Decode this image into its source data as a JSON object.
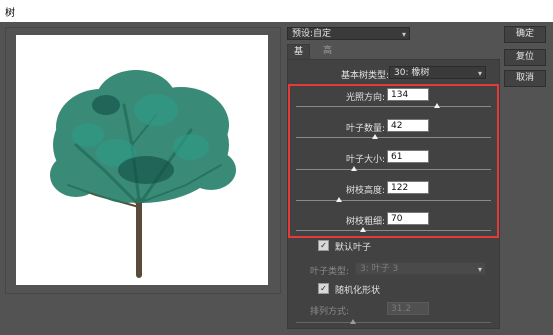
{
  "window": {
    "title": "树"
  },
  "preset": {
    "label": "预设:",
    "value": "自定"
  },
  "tabs": [
    {
      "label": "基本"
    },
    {
      "label": "高级"
    }
  ],
  "tree_type": {
    "label": "基本树类型:",
    "value": "30: 橡树"
  },
  "params": [
    {
      "label": "光照方向:",
      "value": "134"
    },
    {
      "label": "叶子数量:",
      "value": "42"
    },
    {
      "label": "叶子大小:",
      "value": "61"
    },
    {
      "label": "树枝高度:",
      "value": "122"
    },
    {
      "label": "树枝粗细:",
      "value": "70"
    }
  ],
  "default_leaves": {
    "label": "默认叶子",
    "checked": true
  },
  "leaf_type": {
    "label": "叶子类型:",
    "value": "3: 叶子 3"
  },
  "randomize": {
    "label": "随机化形状",
    "checked": true
  },
  "arrangement": {
    "label": "排列方式:",
    "value": "31.2"
  },
  "buttons": {
    "ok": "确定",
    "reset": "复位",
    "cancel": "取消"
  },
  "colors": {
    "highlight": "#e33a3a",
    "foliage": "#1f7a66"
  }
}
